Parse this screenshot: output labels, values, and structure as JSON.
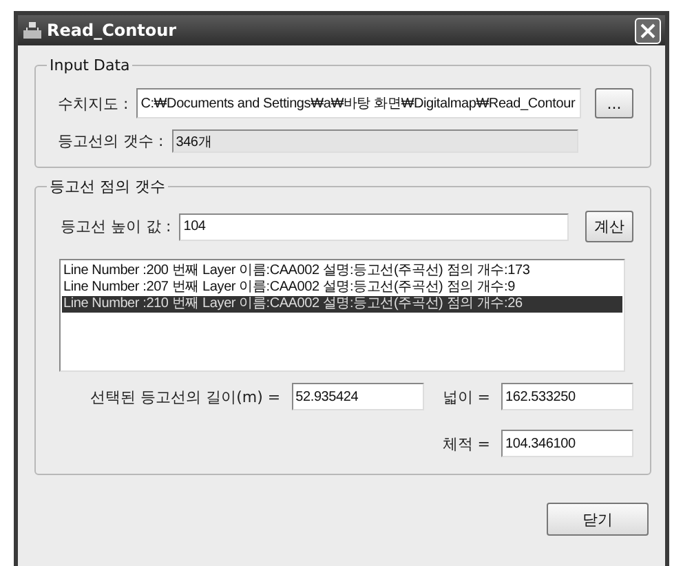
{
  "window": {
    "title": "Read_Contour"
  },
  "input_group": {
    "title": "Input Data",
    "map_label": "수치지도 :",
    "map_path": "C:₩Documents and Settings₩a₩바탕 화면₩Digitalmap₩Read_Contour",
    "browse_button": "...",
    "count_label": "등고선의 갯수 :",
    "count_value": "346개"
  },
  "points_group": {
    "title": "등고선 점의 갯수",
    "height_label": "등고선 높이 값 :",
    "height_value": "104",
    "calc_button": "계산",
    "lines": [
      {
        "text": "Line Number :200 번째 Layer 이름:CAA002  설명:등고선(주곡선) 점의 개수:173",
        "selected": false
      },
      {
        "text": "Line Number :207 번째 Layer 이름:CAA002  설명:등고선(주곡선) 점의 개수:9",
        "selected": false
      },
      {
        "text": "Line Number :210 번째 Layer 이름:CAA002  설명:등고선(주곡선) 점의 개수:26",
        "selected": true
      }
    ],
    "length_label": "선택된 등고선의 길이(m) =",
    "length_value": "52.935424",
    "area_label": "넓이 =",
    "area_value": "162.533250",
    "volume_label": "체적 =",
    "volume_value": "104.346100"
  },
  "close_button": "닫기"
}
